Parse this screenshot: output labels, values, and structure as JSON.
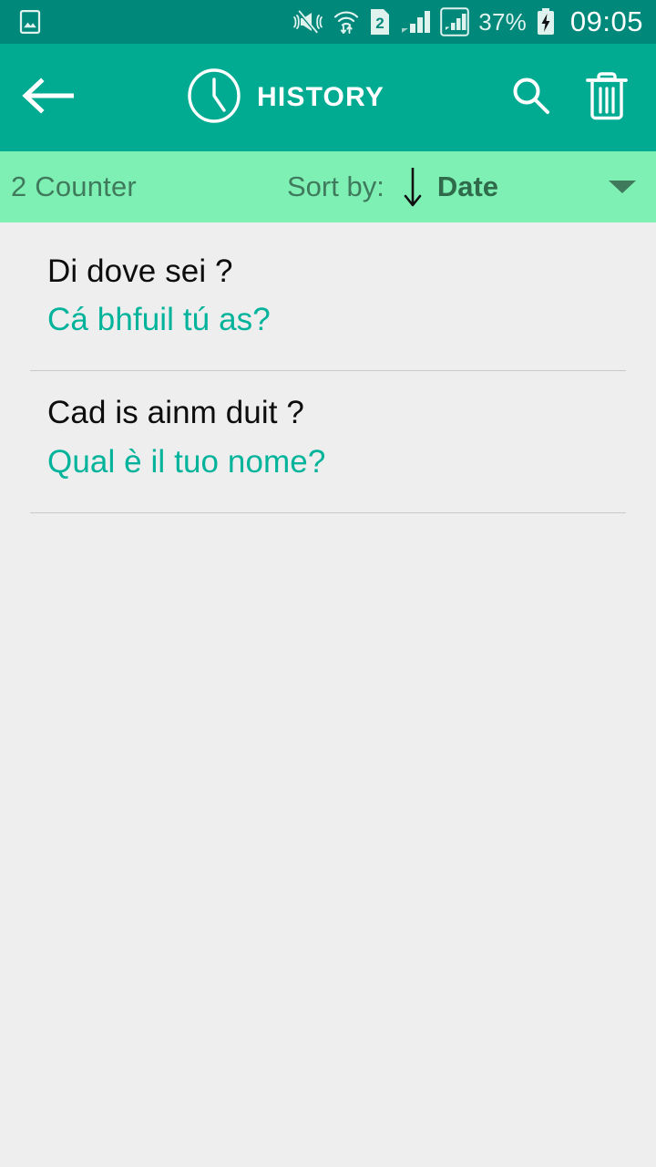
{
  "status_bar": {
    "left_icons": [
      {
        "name": "gallery-image-icon",
        "label": "Gallery"
      }
    ],
    "right_icons": [
      {
        "name": "vibrate-mute-icon",
        "label": "Sound off / vibrate"
      },
      {
        "name": "wifi-transfer-icon",
        "label": "Wi-Fi with data transfer"
      },
      {
        "name": "sim-2-icon",
        "label": "2"
      },
      {
        "name": "signal-bars-icon",
        "label": "Signal strength"
      },
      {
        "name": "signal-bars-boxed-icon",
        "label": "Second SIM signal"
      }
    ],
    "battery_percent": "37%",
    "battery_state": "charging",
    "clock": "09:05",
    "background_color": "#00887a"
  },
  "app_bar": {
    "back_label": "Back",
    "clock_icon": "clock-icon",
    "title": "HISTORY",
    "search_label": "Search",
    "delete_label": "Delete all",
    "background_color": "#00ab92",
    "title_color": "#ffffff"
  },
  "sort_bar": {
    "counter": "2 Counter",
    "sort_by_label": "Sort by:",
    "sort_direction": "descending",
    "sort_value": "Date",
    "dropdown_icon": "chevron-down-icon",
    "background_color": "#7ff0b4",
    "text_color": "#3f7a5c"
  },
  "history": {
    "accent_color": "#00b39a",
    "source_color": "#0d0d0d",
    "items": [
      {
        "source_text": "Di dove sei ?",
        "target_text": "Cá bhfuil tú as?"
      },
      {
        "source_text": "Cad is ainm duit ?",
        "target_text": "Qual è il tuo nome?"
      }
    ]
  }
}
